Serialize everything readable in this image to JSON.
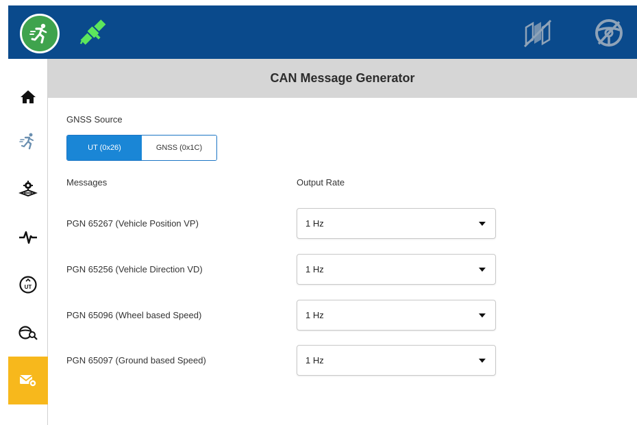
{
  "header": {
    "title": "CAN Message Generator"
  },
  "gnss": {
    "label": "GNSS Source",
    "options": [
      "UT (0x26)",
      "GNSS (0x1C)"
    ],
    "selected": "UT (0x26)"
  },
  "columns": {
    "messages": "Messages",
    "output_rate": "Output Rate"
  },
  "messages": [
    {
      "pgn": "PGN 65267 (Vehicle Position VP)",
      "rate": "1 Hz"
    },
    {
      "pgn": "PGN 65256 (Vehicle Direction VD)",
      "rate": "1 Hz"
    },
    {
      "pgn": "PGN 65096 (Wheel based Speed)",
      "rate": "1 Hz"
    },
    {
      "pgn": "PGN 65097 (Ground based Speed)",
      "rate": "1 Hz"
    }
  ],
  "sidebar": {
    "items": [
      {
        "icon": "home-icon"
      },
      {
        "icon": "runner-icon"
      },
      {
        "icon": "field-settings-icon"
      },
      {
        "icon": "pulse-icon"
      },
      {
        "icon": "ut-icon"
      },
      {
        "icon": "steering-search-icon"
      },
      {
        "icon": "message-gear-icon",
        "active": true
      }
    ]
  },
  "colors": {
    "topbar": "#0a4a8c",
    "logo": "#3fa34d",
    "satellite": "#5ce65c",
    "accent": "#1a86d6",
    "active_nav": "#f7b81c",
    "header_band": "#d6d6d6"
  }
}
